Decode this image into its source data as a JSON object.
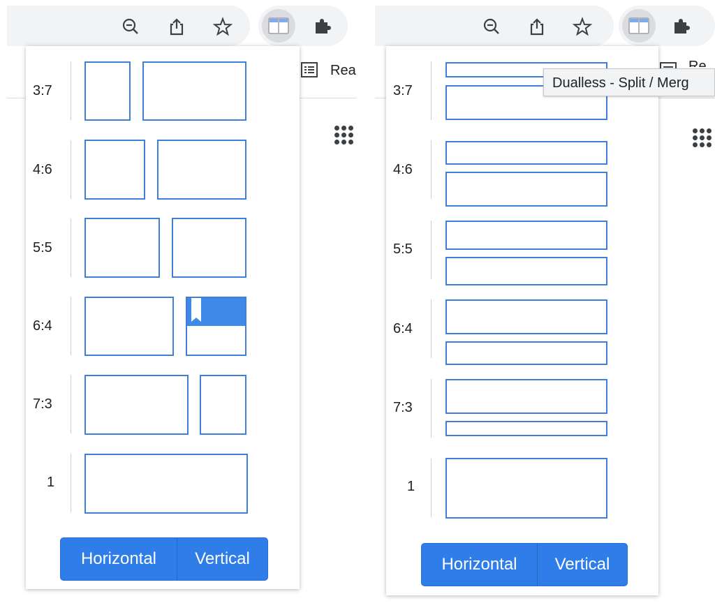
{
  "colors": {
    "accent": "#3f7fd8",
    "button": "#2f7de9",
    "toolbar": "#f1f3f4"
  },
  "toolbar_icons": [
    "zoom-out-icon",
    "share-icon",
    "star-icon",
    "split-view-icon",
    "puzzle-icon"
  ],
  "background": {
    "reader_label_left": "Rea",
    "reader_label_right": "Re"
  },
  "tooltip": {
    "text": "Dualless - Split / Merg"
  },
  "popup": {
    "ratios": [
      "3:7",
      "4:6",
      "5:5",
      "6:4",
      "7:3",
      "1"
    ],
    "horizontal_label": "Horizontal",
    "vertical_label": "Vertical"
  }
}
